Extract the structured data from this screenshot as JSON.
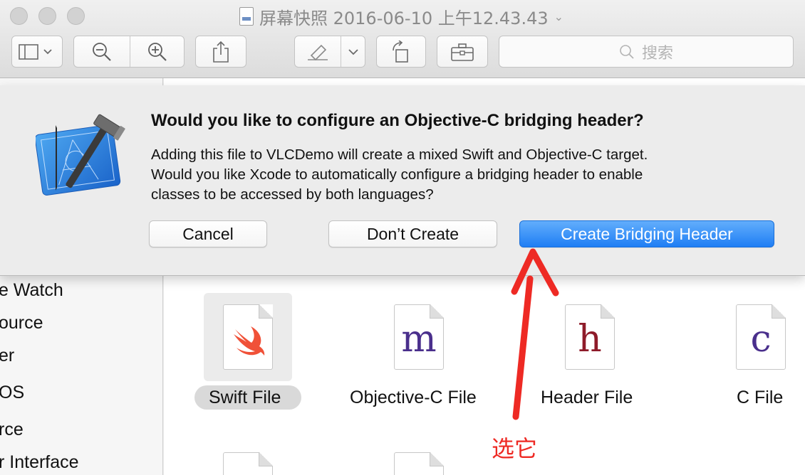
{
  "window": {
    "title": "屏幕快照 2016-06-10 上午12.43.43",
    "search_placeholder": "搜索"
  },
  "toolbar": {
    "icons": [
      "sidebar-toggle-icon",
      "zoom-out-icon",
      "zoom-in-icon",
      "share-icon",
      "markup-pen-icon",
      "rotate-icon",
      "toolbox-icon"
    ]
  },
  "alert": {
    "title": "Would you like to configure an Objective-C bridging header?",
    "body_lines": [
      "Adding this file to VLCDemo will create a mixed Swift and Objective-C target.",
      "Would you like Xcode to automatically configure a bridging header to enable",
      "classes to be accessed by both languages?"
    ],
    "cancel_label": "Cancel",
    "dont_create_label": "Don’t Create",
    "create_label": "Create Bridging Header"
  },
  "sidebar": {
    "items": [
      "e Watch",
      "ource",
      "er",
      "OS",
      "rce",
      "r Interface"
    ]
  },
  "templates": [
    {
      "label": "Swift File",
      "letter": "",
      "selected": true
    },
    {
      "label": "Objective-C File",
      "letter": "m",
      "color": "#4a2f8c"
    },
    {
      "label": "Header File",
      "letter": "h",
      "color": "#8e1b2a"
    },
    {
      "label": "C File",
      "letter": "c",
      "color": "#4a2f8c"
    }
  ],
  "annotation": {
    "text": "选它",
    "color": "#ee2a24"
  },
  "colors": {
    "primary_button": "#2a86f6",
    "swift_orange": "#f05138"
  }
}
